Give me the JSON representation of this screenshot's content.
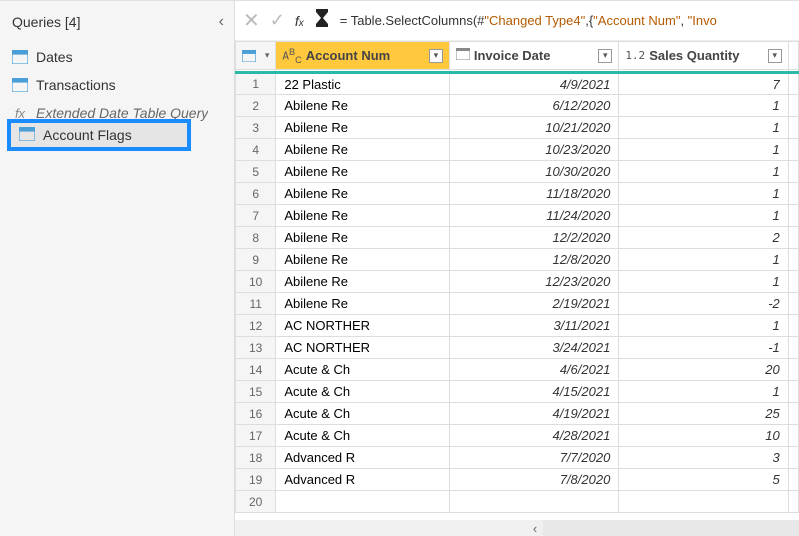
{
  "sidebar": {
    "title": "Queries [4]",
    "items": [
      {
        "label": "Dates",
        "icon": "table"
      },
      {
        "label": "Transactions",
        "icon": "table"
      },
      {
        "label": "Extended Date Table Query",
        "icon": "fx"
      },
      {
        "label": "Account Flags",
        "icon": "table"
      }
    ],
    "selected_index": 3
  },
  "formula_bar": {
    "prefix": "= Table.SelectColumns(#",
    "str1": "\"Changed Type4\"",
    "mid": ",{",
    "str2": "\"Account Num\"",
    "sep": ", ",
    "str3": "\"Invo"
  },
  "columns": [
    {
      "type_label": "A³ᴄ",
      "name": "Account Num",
      "class": "col-acc"
    },
    {
      "type_label": "",
      "name": "Invoice Date",
      "class": "col-inv",
      "icon": "cal"
    },
    {
      "type_label": "1.2",
      "name": "Sales Quantity",
      "class": "col-qty"
    }
  ],
  "rows": [
    {
      "n": 1,
      "acc": "22 Plastic",
      "inv": "4/9/2021",
      "qty": "7"
    },
    {
      "n": 2,
      "acc": "Abilene Re",
      "inv": "6/12/2020",
      "qty": "1"
    },
    {
      "n": 3,
      "acc": "Abilene Re",
      "inv": "10/21/2020",
      "qty": "1"
    },
    {
      "n": 4,
      "acc": "Abilene Re",
      "inv": "10/23/2020",
      "qty": "1"
    },
    {
      "n": 5,
      "acc": "Abilene Re",
      "inv": "10/30/2020",
      "qty": "1"
    },
    {
      "n": 6,
      "acc": "Abilene Re",
      "inv": "11/18/2020",
      "qty": "1"
    },
    {
      "n": 7,
      "acc": "Abilene Re",
      "inv": "11/24/2020",
      "qty": "1"
    },
    {
      "n": 8,
      "acc": "Abilene Re",
      "inv": "12/2/2020",
      "qty": "2"
    },
    {
      "n": 9,
      "acc": "Abilene Re",
      "inv": "12/8/2020",
      "qty": "1"
    },
    {
      "n": 10,
      "acc": "Abilene Re",
      "inv": "12/23/2020",
      "qty": "1"
    },
    {
      "n": 11,
      "acc": "Abilene Re",
      "inv": "2/19/2021",
      "qty": "-2"
    },
    {
      "n": 12,
      "acc": "AC NORTHER",
      "inv": "3/11/2021",
      "qty": "1"
    },
    {
      "n": 13,
      "acc": "AC NORTHER",
      "inv": "3/24/2021",
      "qty": "-1"
    },
    {
      "n": 14,
      "acc": "Acute & Ch",
      "inv": "4/6/2021",
      "qty": "20"
    },
    {
      "n": 15,
      "acc": "Acute & Ch",
      "inv": "4/15/2021",
      "qty": "1"
    },
    {
      "n": 16,
      "acc": "Acute & Ch",
      "inv": "4/19/2021",
      "qty": "25"
    },
    {
      "n": 17,
      "acc": "Acute & Ch",
      "inv": "4/28/2021",
      "qty": "10"
    },
    {
      "n": 18,
      "acc": "Advanced R",
      "inv": "7/7/2020",
      "qty": "3"
    },
    {
      "n": 19,
      "acc": "Advanced R",
      "inv": "7/8/2020",
      "qty": "5"
    },
    {
      "n": 20,
      "acc": "",
      "inv": "",
      "qty": ""
    }
  ]
}
